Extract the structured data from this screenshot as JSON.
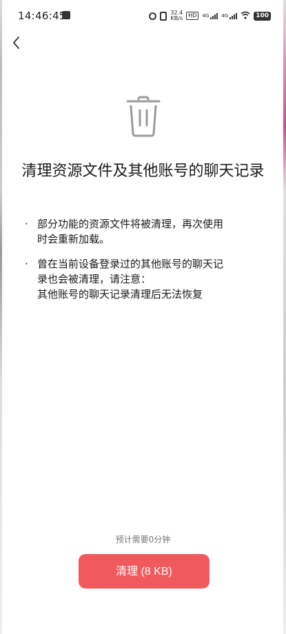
{
  "status_bar": {
    "time": "14:46:45",
    "speed_value": "32.4",
    "speed_unit": "KB/s",
    "hd_label": "HD",
    "sim1_tag": "4G",
    "sim2_tag": "4G",
    "battery": "100"
  },
  "header": {
    "back_icon": "chevron-left-icon"
  },
  "main": {
    "icon": "trash-icon",
    "title": "清理资源文件及其他账号的聊天记录",
    "bullets": [
      {
        "lines": [
          "部分功能的资源文件将被清理，再次使用",
          "时会重新加载。"
        ]
      },
      {
        "lines": [
          "曾在当前设备登录过的其他账号的聊天记",
          "录也会被清理，请注意：",
          "其他账号的聊天记录清理后无法恢复"
        ]
      }
    ],
    "bullet_symbol": "·"
  },
  "footer": {
    "estimate": "预计需要0分钟",
    "clean_button_label": "清理 (8 KB)",
    "accent_color": "#f05a5e"
  }
}
